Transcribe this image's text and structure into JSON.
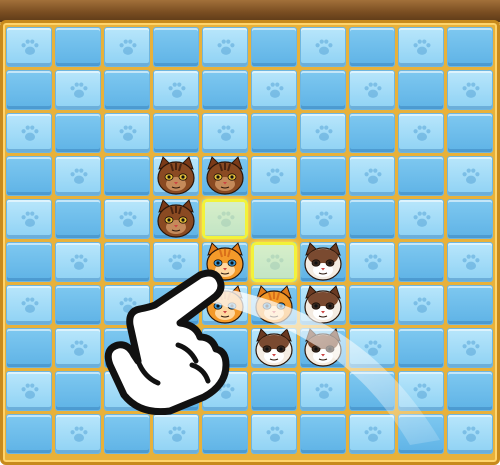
{
  "board": {
    "columns": 10,
    "rows": 10,
    "tile_colors": {
      "light": "#a6dcf7",
      "dark": "#6cbdea",
      "frame": "#e8b13a"
    }
  },
  "pieces": [
    {
      "type": "brown-tabby-cat",
      "col": 3,
      "row": 3
    },
    {
      "type": "brown-tabby-cat",
      "col": 4,
      "row": 3
    },
    {
      "type": "brown-tabby-cat",
      "col": 3,
      "row": 4
    },
    {
      "type": "orange-cat",
      "col": 4,
      "row": 5
    },
    {
      "type": "orange-cat",
      "col": 4,
      "row": 6
    },
    {
      "type": "orange-cat",
      "col": 5,
      "row": 6
    },
    {
      "type": "siamese-cat",
      "col": 6,
      "row": 5
    },
    {
      "type": "siamese-cat",
      "col": 6,
      "row": 6
    },
    {
      "type": "siamese-cat",
      "col": 5,
      "row": 7
    },
    {
      "type": "siamese-cat",
      "col": 6,
      "row": 7
    }
  ],
  "highlighted_cells": [
    {
      "col": 4,
      "row": 4
    },
    {
      "col": 5,
      "row": 5
    }
  ],
  "tutorial": {
    "gesture": "swipe",
    "hand_icon": "pointing-hand-icon"
  }
}
